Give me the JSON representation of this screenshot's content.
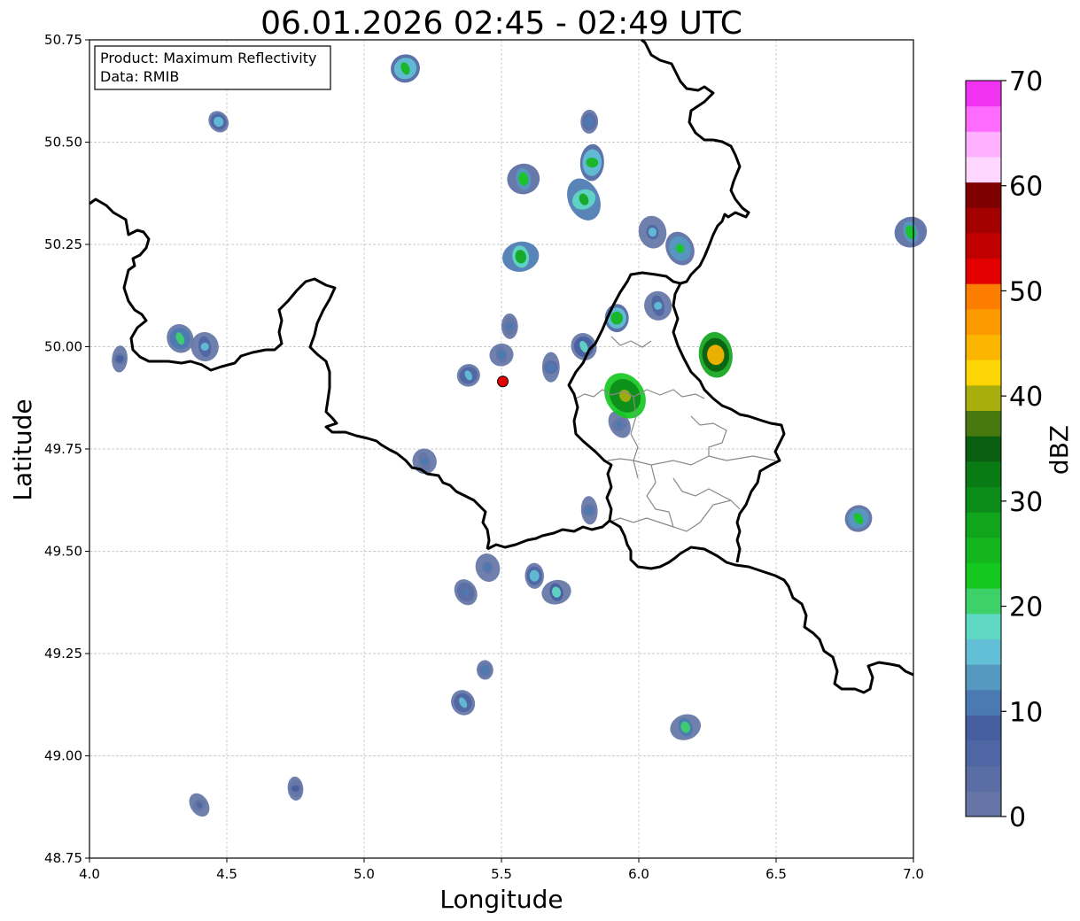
{
  "title": "06.01.2026 02:45 - 02:49 UTC",
  "info_box": {
    "line1": "Product: Maximum Reflectivity",
    "line2": "Data: RMIB"
  },
  "axes": {
    "xlabel": "Longitude",
    "ylabel": "Latitude",
    "xlim": [
      4.0,
      7.0
    ],
    "ylim": [
      48.75,
      50.75
    ],
    "xticks": [
      "4.0",
      "4.5",
      "5.0",
      "5.5",
      "6.0",
      "6.5",
      "7.0"
    ],
    "yticks": [
      "48.75",
      "49.00",
      "49.25",
      "49.50",
      "49.75",
      "50.00",
      "50.25",
      "50.50",
      "50.75"
    ],
    "grid": true
  },
  "colorbar": {
    "label": "dBZ",
    "range": [
      0,
      70
    ],
    "tick_labels": [
      "0",
      "10",
      "20",
      "30",
      "40",
      "50",
      "60",
      "70"
    ],
    "colors": [
      "#6475a6",
      "#5a6da4",
      "#4e66a3",
      "#465fa1",
      "#4b7ab2",
      "#5599c0",
      "#63bfd6",
      "#5fd9c3",
      "#3ed16a",
      "#14c81f",
      "#14b61e",
      "#11a51c",
      "#0c8c18",
      "#0a7a15",
      "#0a5e10",
      "#47790f",
      "#a8ae0d",
      "#fdd504",
      "#fdb600",
      "#fd9a00",
      "#fd7d00",
      "#e30000",
      "#c00000",
      "#a30000",
      "#7e0000",
      "#ffd6ff",
      "#ffb0ff",
      "#ff6bff",
      "#f033f0"
    ]
  },
  "radar_site": {
    "lon": 5.505,
    "lat": 49.915,
    "color": "#e00000"
  },
  "colors": {
    "border": "#000000",
    "region": "#888888",
    "grid": "#bbbbbb"
  },
  "chart_data": {
    "type": "heatmap",
    "title": "06.01.2026 02:45 - 02:49 UTC",
    "xlabel": "Longitude",
    "ylabel": "Latitude",
    "xlim": [
      4.0,
      7.0
    ],
    "ylim": [
      48.75,
      50.75
    ],
    "value_label": "dBZ",
    "value_range": [
      0,
      70
    ],
    "echo_cells": [
      {
        "lon": 4.47,
        "lat": 50.55,
        "dbz": 15
      },
      {
        "lon": 4.33,
        "lat": 50.02,
        "dbz": 20
      },
      {
        "lon": 4.42,
        "lat": 50.0,
        "dbz": 15
      },
      {
        "lon": 4.11,
        "lat": 49.97,
        "dbz": 8
      },
      {
        "lon": 5.15,
        "lat": 50.68,
        "dbz": 25
      },
      {
        "lon": 5.58,
        "lat": 50.41,
        "dbz": 22
      },
      {
        "lon": 5.83,
        "lat": 50.45,
        "dbz": 25
      },
      {
        "lon": 5.8,
        "lat": 50.36,
        "dbz": 28
      },
      {
        "lon": 5.57,
        "lat": 50.22,
        "dbz": 28
      },
      {
        "lon": 5.82,
        "lat": 50.55,
        "dbz": 12
      },
      {
        "lon": 6.15,
        "lat": 50.24,
        "dbz": 22
      },
      {
        "lon": 6.05,
        "lat": 50.28,
        "dbz": 15
      },
      {
        "lon": 5.92,
        "lat": 50.07,
        "dbz": 25
      },
      {
        "lon": 5.8,
        "lat": 50.0,
        "dbz": 18
      },
      {
        "lon": 6.07,
        "lat": 50.1,
        "dbz": 15
      },
      {
        "lon": 5.68,
        "lat": 49.95,
        "dbz": 12
      },
      {
        "lon": 5.38,
        "lat": 49.93,
        "dbz": 15
      },
      {
        "lon": 5.5,
        "lat": 49.98,
        "dbz": 10
      },
      {
        "lon": 5.53,
        "lat": 50.05,
        "dbz": 10
      },
      {
        "lon": 5.93,
        "lat": 49.81,
        "dbz": 10
      },
      {
        "lon": 5.7,
        "lat": 49.4,
        "dbz": 18
      },
      {
        "lon": 5.62,
        "lat": 49.44,
        "dbz": 15
      },
      {
        "lon": 5.37,
        "lat": 49.4,
        "dbz": 12
      },
      {
        "lon": 5.45,
        "lat": 49.46,
        "dbz": 10
      },
      {
        "lon": 5.44,
        "lat": 49.21,
        "dbz": 10
      },
      {
        "lon": 5.36,
        "lat": 49.13,
        "dbz": 15
      },
      {
        "lon": 5.22,
        "lat": 49.72,
        "dbz": 10
      },
      {
        "lon": 5.82,
        "lat": 49.6,
        "dbz": 10
      },
      {
        "lon": 6.8,
        "lat": 49.58,
        "dbz": 22
      },
      {
        "lon": 6.99,
        "lat": 50.28,
        "dbz": 22
      },
      {
        "lon": 4.75,
        "lat": 48.92,
        "dbz": 8
      },
      {
        "lon": 4.4,
        "lat": 48.88,
        "dbz": 6
      },
      {
        "lon": 6.17,
        "lat": 49.07,
        "dbz": 20
      },
      {
        "lon": 6.28,
        "lat": 49.98,
        "dbz": 45
      },
      {
        "lon": 5.95,
        "lat": 49.88,
        "dbz": 40
      }
    ]
  }
}
